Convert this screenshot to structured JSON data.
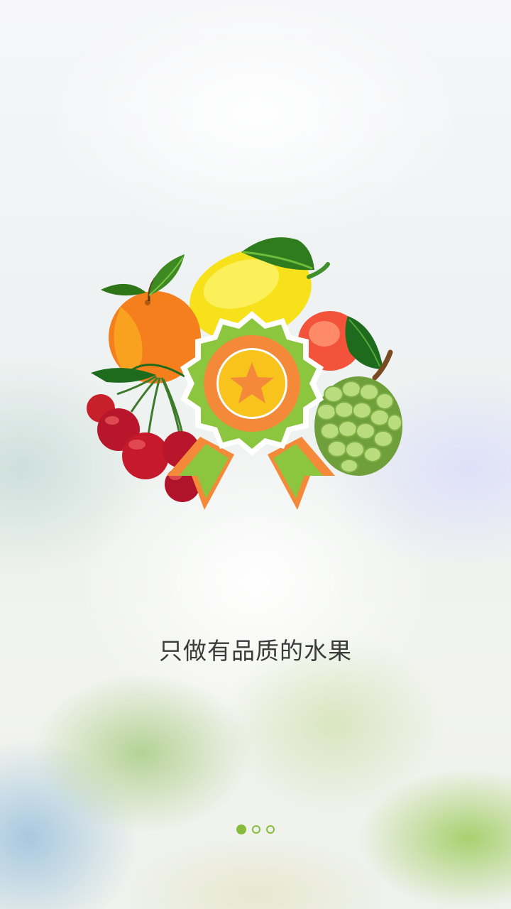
{
  "screen": "onboarding",
  "tagline": "只做有品质的水果",
  "pager": {
    "total": 3,
    "active_index": 0
  },
  "illustration": {
    "fruits": [
      "orange-icon",
      "lemon-icon",
      "peach-icon",
      "custard-apple-icon",
      "cherries-icon"
    ],
    "badge": "quality-medal-icon"
  },
  "colors": {
    "accent_green": "#86bc3a",
    "badge_orange": "#f5893a",
    "badge_yellow": "#f7c31c",
    "text": "#3b3b3b"
  }
}
